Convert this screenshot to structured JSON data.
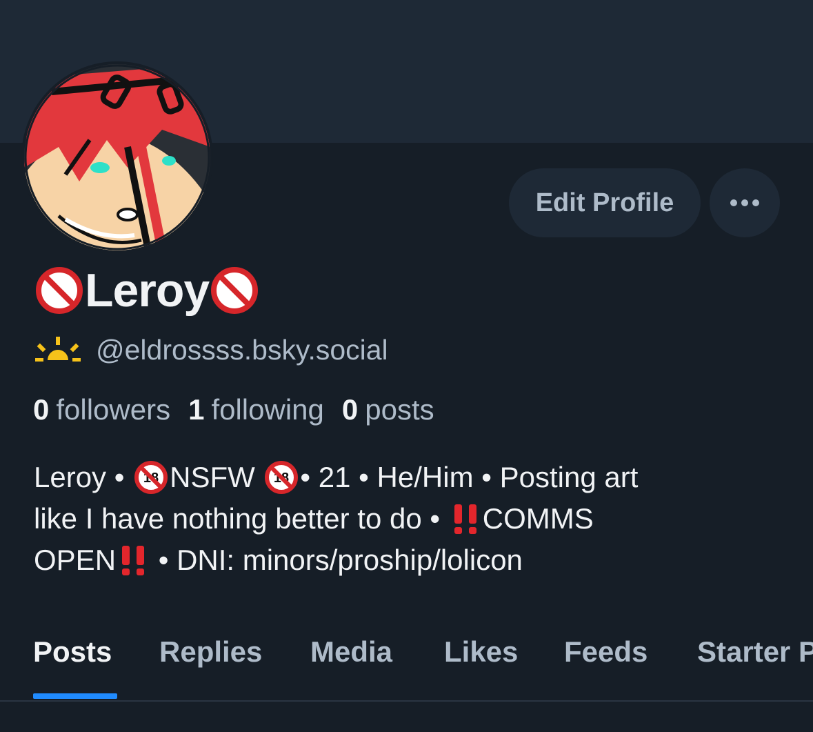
{
  "profile": {
    "display_name": "Leroy",
    "handle": "@eldrossss.bsky.social",
    "avatar_icon": "avatar-illustration",
    "name_emoji": "no-entry-icon",
    "handle_emoji": "sunrise-icon"
  },
  "actions": {
    "edit_label": "Edit Profile",
    "more_icon": "ellipsis-icon"
  },
  "stats": {
    "followers": {
      "count": "0",
      "label": "followers"
    },
    "following": {
      "count": "1",
      "label": "following"
    },
    "posts": {
      "count": "0",
      "label": "posts"
    }
  },
  "bio": {
    "line1_a": "Leroy • ",
    "line1_b": "NSFW ",
    "line1_c": "• 21 • He/Him • Posting art",
    "line2_a": "like I have nothing better to do • ",
    "line2_b": "COMMS",
    "line3_a": "OPEN",
    "line3_b": " • DNI: minors/proship/lolicon"
  },
  "tabs": [
    {
      "label": "Posts",
      "active": true
    },
    {
      "label": "Replies"
    },
    {
      "label": "Media"
    },
    {
      "label": "Likes"
    },
    {
      "label": "Feeds"
    },
    {
      "label": "Starter Packs"
    }
  ],
  "colors": {
    "background": "#161e27",
    "banner": "#1e2936",
    "accent": "#208bfe",
    "text_primary": "#f1f3f5",
    "text_secondary": "#aebbc9"
  }
}
